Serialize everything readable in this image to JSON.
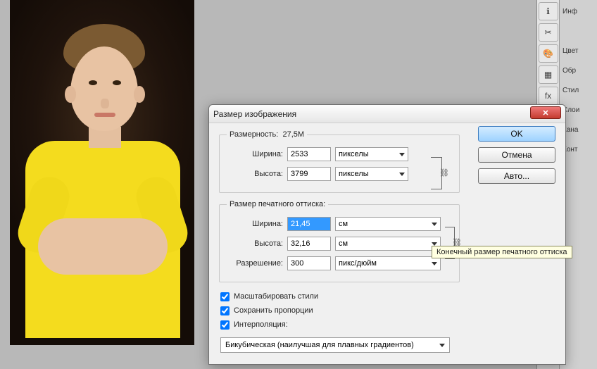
{
  "dialog": {
    "title": "Размер изображения",
    "pixel_dimensions": {
      "legend_prefix": "Размерность:",
      "memory": "27,5M",
      "width_label": "Ширина:",
      "width_value": "2533",
      "height_label": "Высота:",
      "height_value": "3799",
      "unit": "пикселы"
    },
    "print_dimensions": {
      "legend": "Размер печатного оттиска:",
      "width_label": "Ширина:",
      "width_value": "21,45",
      "height_label": "Высота:",
      "height_value": "32,16",
      "unit": "см",
      "resolution_label": "Разрешение:",
      "resolution_value": "300",
      "resolution_unit": "пикс/дюйм"
    },
    "checks": {
      "scale_styles": "Масштабировать стили",
      "constrain": "Сохранить пропорции",
      "resample": "Интерполяция:"
    },
    "interpolation": "Бикубическая (наилучшая для плавных градиентов)",
    "buttons": {
      "ok": "OK",
      "cancel": "Отмена",
      "auto": "Авто..."
    },
    "tooltip": "Конечный размер печатного оттиска",
    "close_glyph": "✕",
    "link_glyph": "⛓"
  },
  "panels": {
    "items": [
      "Инф",
      "",
      "Цвет",
      "Обр",
      "Стил",
      "Слои",
      "Кана",
      "Конт"
    ],
    "icons": [
      "ℹ",
      "✂",
      "🎨",
      "▦",
      "fx",
      "◧",
      "≋",
      "◆"
    ]
  }
}
